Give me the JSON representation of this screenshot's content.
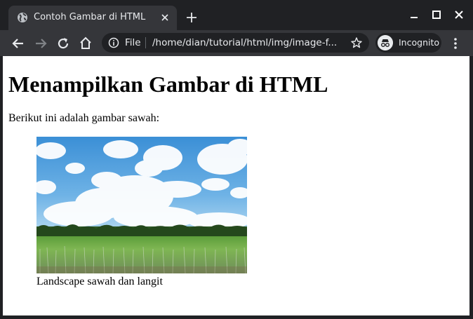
{
  "browser": {
    "tab": {
      "title": "Contoh Gambar di HTML",
      "favicon": "globe-icon"
    },
    "omnibox": {
      "scheme": "File",
      "url": "/home/dian/tutorial/html/img/image-f..."
    },
    "profile": {
      "label": "Incognito"
    },
    "colors": {
      "frame": "#202124",
      "toolbar": "#35363a",
      "text": "#e8eaed"
    }
  },
  "page": {
    "heading": "Menampilkan Gambar di HTML",
    "intro": "Berikut ini adalah gambar sawah:",
    "figure": {
      "image": "rice-field-landscape",
      "caption": "Landscape sawah dan langit"
    }
  }
}
